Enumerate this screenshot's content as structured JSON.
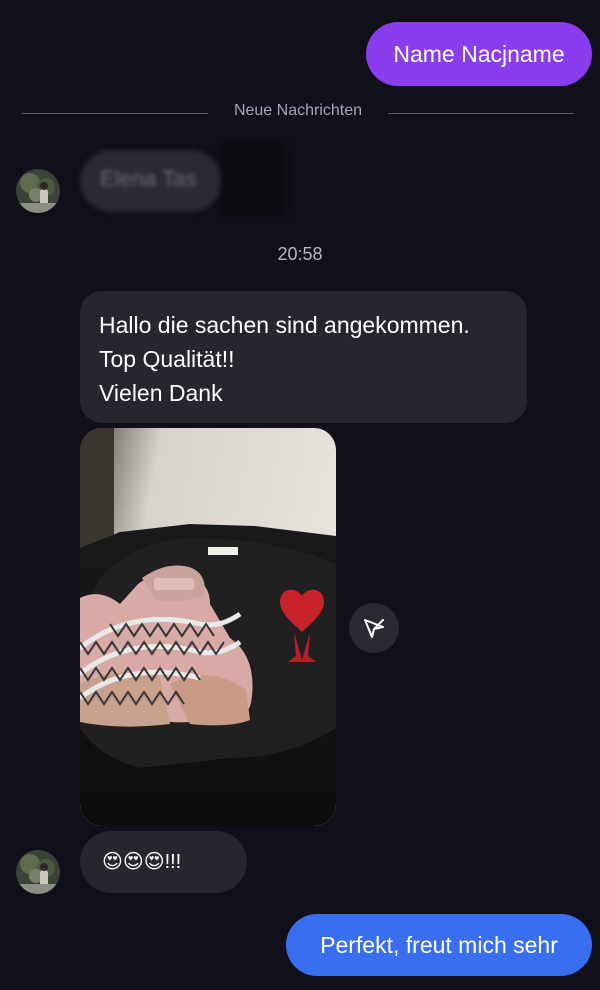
{
  "chat": {
    "outgoing_top": "Name Nacjname",
    "divider_label": "Neue Nachrichten",
    "sender_name": "Elena Tas",
    "timestamp": "20:58",
    "incoming_text": {
      "line1": "Hallo die sachen sind angekommen.",
      "line2": "Top Qualität!!",
      "line3": "Vielen Dank"
    },
    "emoji_message": {
      "emojis": "😍😍😍",
      "suffix": "!!!"
    },
    "outgoing_bottom": "Perfekt, freut mich sehr"
  },
  "photo": {
    "description_icon": "photo-attachment",
    "shirt_logo_color": "#c8232c",
    "shirt_color": "#1f1e1f",
    "shoe_color": "#d9a9a8"
  },
  "icons": {
    "share": "send-arrow-icon"
  },
  "colors": {
    "background": "#100f1a",
    "outgoing_purple": "#8a3ded",
    "outgoing_blue": "#3a6ef0",
    "incoming_bubble": "#26262e"
  }
}
